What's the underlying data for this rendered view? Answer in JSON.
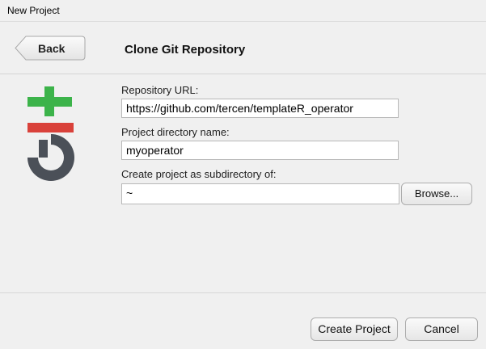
{
  "window": {
    "title": "New Project"
  },
  "header": {
    "back_label": "Back",
    "page_title": "Clone Git Repository"
  },
  "logo": {
    "icon": "git-logo-icon",
    "colors": {
      "plus": "#3cb34a",
      "bar": "#d9413a",
      "letters": "#4b5058"
    }
  },
  "form": {
    "repo_url_label": "Repository URL:",
    "repo_url_value": "https://github.com/tercen/templateR_operator",
    "dir_name_label": "Project directory name:",
    "dir_name_value": "myoperator",
    "subdir_label": "Create project as subdirectory of:",
    "subdir_value": "~",
    "browse_label": "Browse..."
  },
  "footer": {
    "create_label": "Create Project",
    "cancel_label": "Cancel"
  }
}
